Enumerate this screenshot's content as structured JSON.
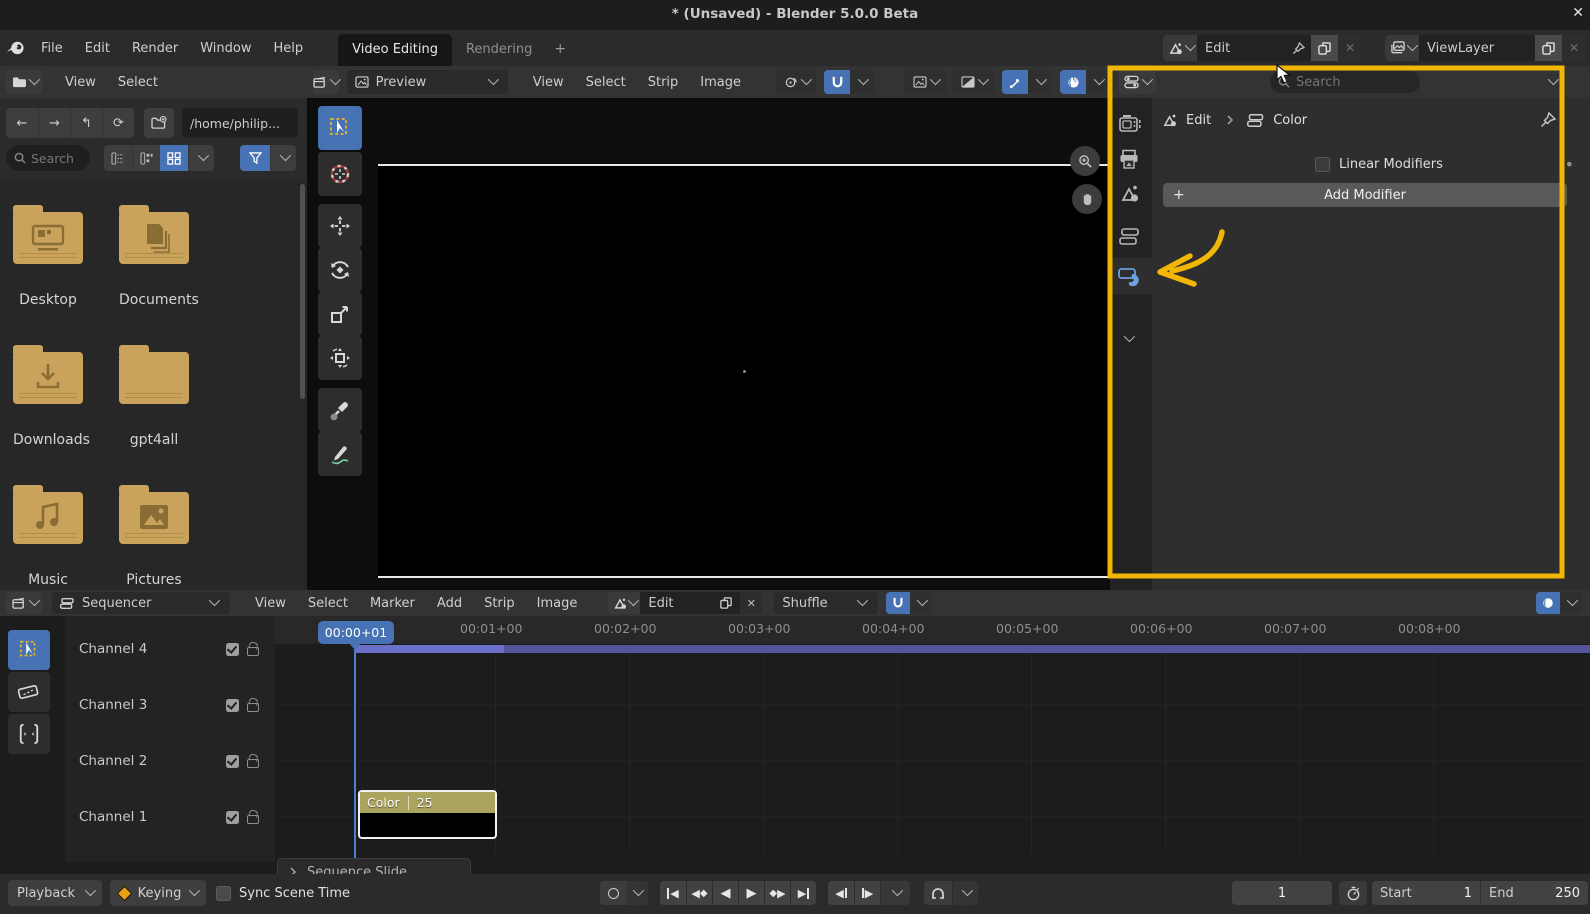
{
  "titlebar": {
    "title": "* (Unsaved) - Blender 5.0.0 Beta",
    "close_glyph": "✕"
  },
  "menubar": {
    "menus": [
      {
        "label": "File"
      },
      {
        "label": "Edit"
      },
      {
        "label": "Render"
      },
      {
        "label": "Window"
      },
      {
        "label": "Help"
      }
    ],
    "workspace_tabs": [
      {
        "label": "Video Editing",
        "active": true
      },
      {
        "label": "Rendering",
        "active": false
      }
    ],
    "add_tab_label": "+",
    "scene_field": {
      "value": "Edit"
    },
    "viewlayer_field": {
      "value": "ViewLayer"
    }
  },
  "file_browser": {
    "menus": [
      {
        "label": "View"
      },
      {
        "label": "Select"
      }
    ],
    "path_value": "/home/philip...",
    "search_placeholder": "Search",
    "folders": [
      {
        "name": "Desktop"
      },
      {
        "name": "Documents"
      },
      {
        "name": "Downloads"
      },
      {
        "name": "gpt4all"
      },
      {
        "name": "Music"
      },
      {
        "name": "Pictures"
      }
    ]
  },
  "preview": {
    "mode_value": "Preview",
    "menus": [
      {
        "label": "View"
      },
      {
        "label": "Select"
      },
      {
        "label": "Strip"
      },
      {
        "label": "Image"
      }
    ]
  },
  "properties": {
    "search_placeholder": "Search",
    "breadcrumb": {
      "scene": "Edit",
      "strip": "Color"
    },
    "linear_modifiers_label": "Linear Modifiers",
    "decorator_dot": "•",
    "add_modifier": {
      "plus": "+",
      "label": "Add Modifier"
    }
  },
  "sequencer": {
    "mode_value": "Sequencer",
    "menus": [
      {
        "label": "View"
      },
      {
        "label": "Select"
      },
      {
        "label": "Marker"
      },
      {
        "label": "Add"
      },
      {
        "label": "Strip"
      },
      {
        "label": "Image"
      }
    ],
    "scene_field": {
      "value": "Edit"
    },
    "snap_mode": {
      "value": "Shuffle"
    },
    "channels": [
      {
        "label": "Channel 4"
      },
      {
        "label": "Channel 3"
      },
      {
        "label": "Channel 2"
      },
      {
        "label": "Channel 1"
      }
    ],
    "ruler": [
      "00:01+00",
      "00:02+00",
      "00:03+00",
      "00:04+00",
      "00:05+00",
      "00:06+00",
      "00:07+00",
      "00:08+00"
    ],
    "playhead_label": "00:00+01",
    "strip": {
      "name": "Color",
      "duration": "25"
    },
    "operator_panel_label": "Sequence Slide"
  },
  "statusbar": {
    "playback_label": "Playback",
    "keying_label": "Keying",
    "sync_label": "Sync Scene Time",
    "frame_value": "1",
    "start_label": "Start",
    "start_value": "1",
    "end_label": "End",
    "end_value": "250"
  },
  "colors": {
    "accent_blue": "#4772b3",
    "annotation_yellow": "#f2b705",
    "folder_tan": "#c9a35b",
    "strip_olive": "#aaa45e"
  },
  "icons": {
    "blender-logo": "blender swirl",
    "search-icon": "magnifier",
    "filter-icon": "funnel",
    "snap-icon": "magnet",
    "overlay-icon": "sphere",
    "pin-icon": "pushpin",
    "copy-icon": "duplicate pages",
    "close-icon": "x",
    "zoom-in-icon": "magnifier plus",
    "pan-hand-icon": "hand",
    "keying-icon": "diamond keyframe",
    "stopwatch-icon": "time",
    "modifier-icon": "wrench on strip"
  }
}
